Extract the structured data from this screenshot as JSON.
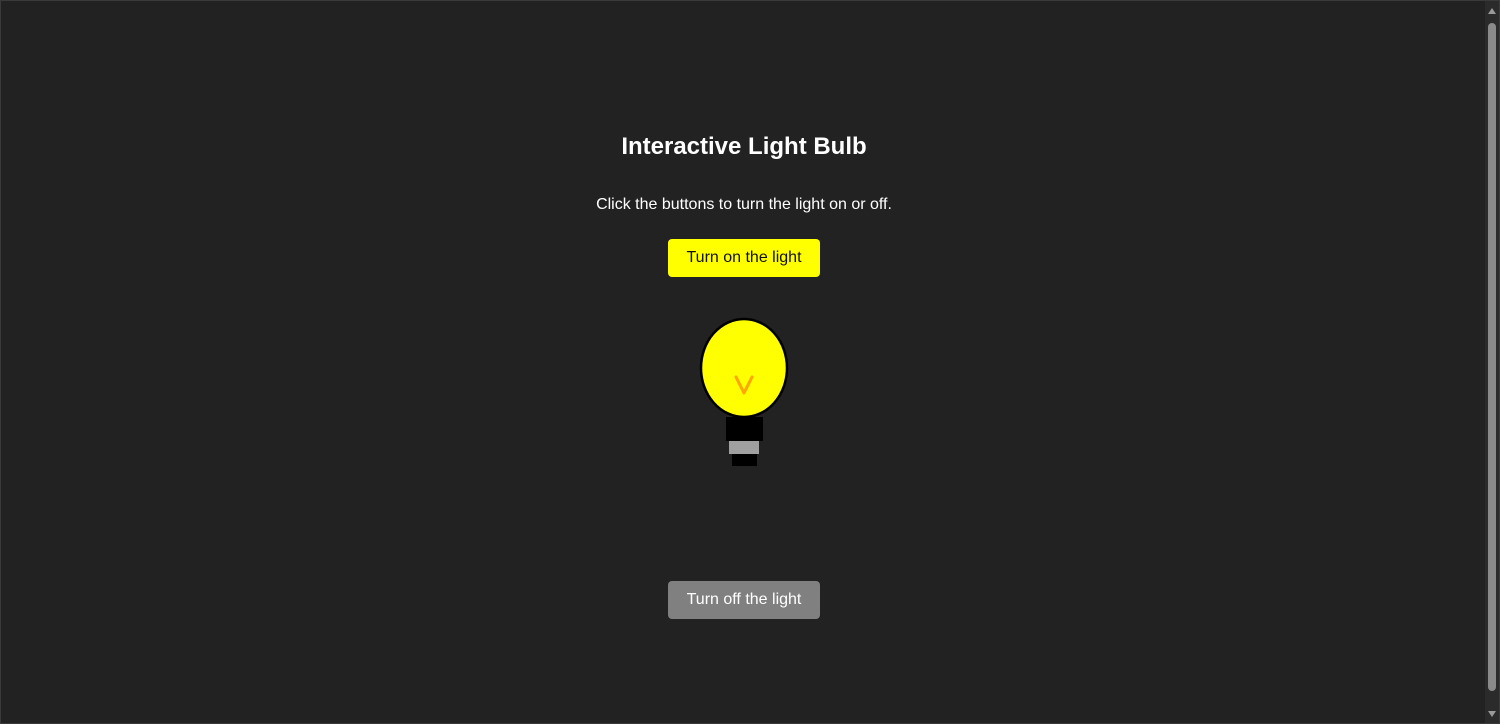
{
  "page": {
    "title": "Interactive Light Bulb",
    "instructions": "Click the buttons to turn the light on or off."
  },
  "controls": {
    "on_label": "Turn on the light",
    "off_label": "Turn off the light"
  },
  "bulb": {
    "state": "on",
    "glass_color": "#ffff00",
    "filament_color": "#ffa500",
    "base_color": "#000000",
    "ring_color": "#a0a0a0"
  },
  "colors": {
    "background": "#222222",
    "on_button": "#ffff00",
    "off_button": "#808080"
  }
}
